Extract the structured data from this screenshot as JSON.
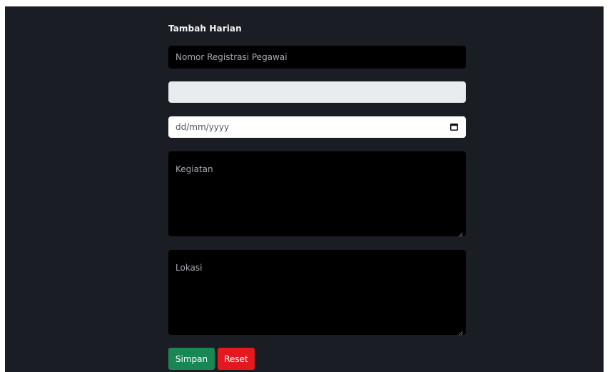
{
  "form": {
    "title": "Tambah Harian",
    "nomor_registrasi": {
      "placeholder": "Nomor Registrasi Pegawai",
      "value": ""
    },
    "disabled_field": {
      "value": ""
    },
    "tanggal": {
      "placeholder": "dd/mm/yyyy",
      "value": "",
      "icon": "calendar-icon"
    },
    "kegiatan": {
      "placeholder": "Kegiatan",
      "value": ""
    },
    "lokasi": {
      "placeholder": "Lokasi",
      "value": ""
    },
    "buttons": {
      "simpan_label": "Simpan",
      "reset_label": "Reset"
    }
  },
  "colors": {
    "background": "#1b1d24",
    "input_dark": "#000000",
    "input_gray": "#e9ecef",
    "simpan": "#198754",
    "reset": "#e3191e"
  }
}
